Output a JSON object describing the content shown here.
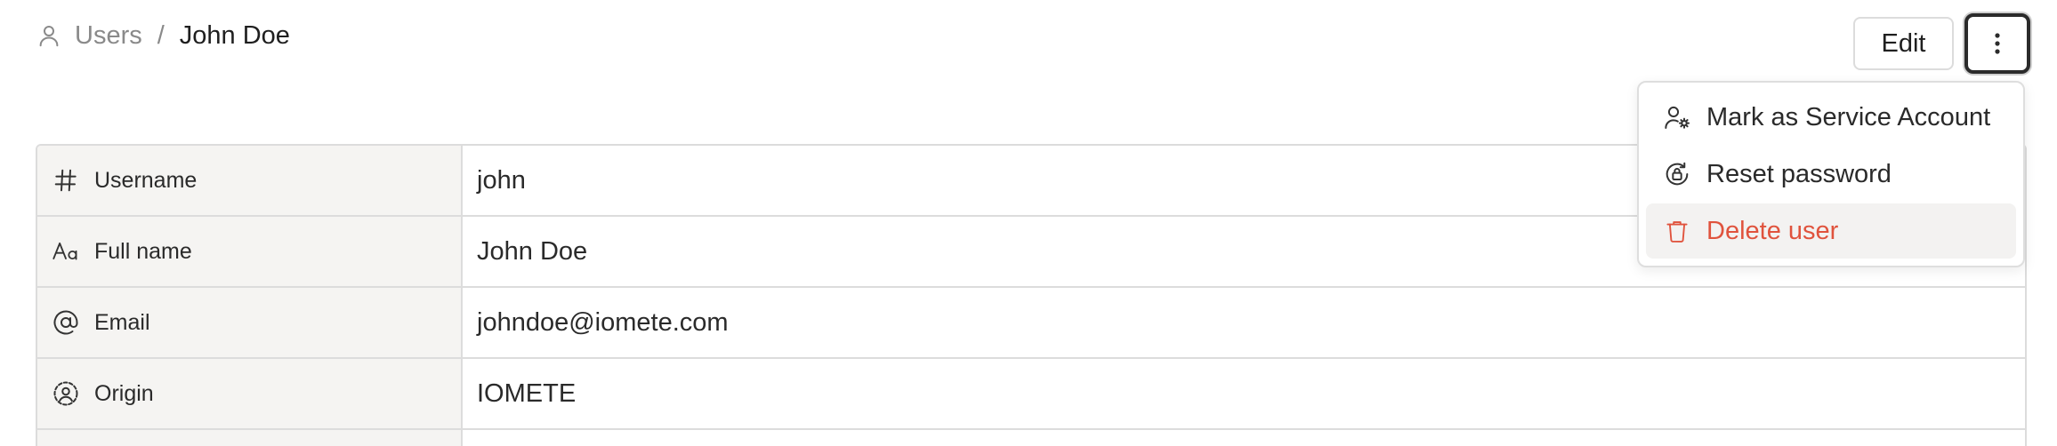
{
  "breadcrumb": {
    "root": "Users",
    "separator": "/",
    "current": "John Doe",
    "root_icon": "user-icon"
  },
  "header": {
    "edit_label": "Edit",
    "more_icon": "more-vertical-icon"
  },
  "details": {
    "rows": [
      {
        "label": "Username",
        "value": "john",
        "icon": "hash-icon"
      },
      {
        "label": "Full name",
        "value": "John Doe",
        "icon": "text-case-icon"
      },
      {
        "label": "Email",
        "value": "johndoe@iomete.com",
        "icon": "at-sign-icon"
      },
      {
        "label": "Origin",
        "value": "IOMETE",
        "icon": "user-circle-icon"
      }
    ]
  },
  "menu": {
    "items": [
      {
        "label": "Mark as Service Account",
        "icon": "user-cog-icon"
      },
      {
        "label": "Reset password",
        "icon": "lock-reset-icon"
      },
      {
        "label": "Delete user",
        "icon": "trash-icon",
        "color": "#e0533d"
      }
    ]
  }
}
